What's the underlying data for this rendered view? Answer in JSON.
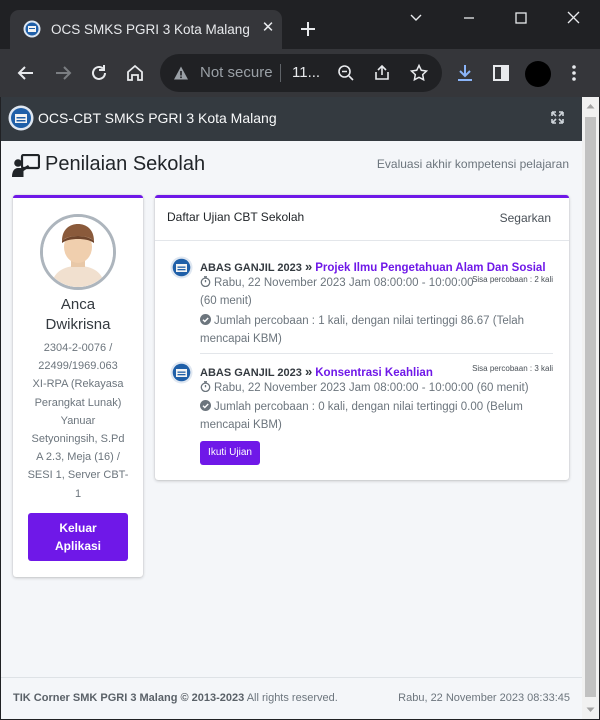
{
  "browser": {
    "tab_title": "OCS SMKS PGRI 3 Kota Malang",
    "security_label": "Not secure",
    "url_text": "11...",
    "colors": {
      "chrome_dark": "#202124",
      "chrome_toolbar": "#35363a"
    }
  },
  "app": {
    "header_title": "OCS-CBT SMKS PGRI 3 Kota Malang",
    "accent_color": "#6f18e8"
  },
  "page": {
    "title": "Penilaian Sekolah",
    "subtitle": "Evaluasi akhir kompetensi pelajaran"
  },
  "student": {
    "first_name": "Anca",
    "last_name": "Dwikrisna",
    "id_line1": "2304-2-0076 /",
    "id_line2": "22499/1969.063",
    "class_line1": "XI-RPA (Rekayasa",
    "class_line2": "Perangkat Lunak)",
    "teacher_line1": "Yanuar",
    "teacher_line2": "Setyoningsih, S.Pd",
    "room_line1": "A 2.3, Meja (16) /",
    "room_line2": "SESI 1, Server CBT-",
    "room_line3": "1",
    "logout_line1": "Keluar",
    "logout_line2": "Aplikasi"
  },
  "exam_list": {
    "title": "Daftar Ujian CBT Sekolah",
    "refresh_label": "Segarkan",
    "items": [
      {
        "session": "ABAS GANJIL 2023",
        "arrows": "»",
        "subject": "Projek Ilmu Pengetahuan Alam Dan Sosial",
        "attempts_left": "Sisa percobaan : 2 kali",
        "schedule_line1": "Rabu, 22 November 2023 Jam 08:00:00 - 10:00:00",
        "schedule_line2": "(60 menit)",
        "result_line1": "Jumlah percobaan : 1 kali, dengan nilai tertinggi 86.67 (Telah",
        "result_line2": "mencapai KBM)"
      },
      {
        "session": "ABAS GANJIL 2023",
        "arrows": "»",
        "subject": "Konsentrasi Keahlian",
        "attempts_left": "Sisa percobaan : 3 kali",
        "schedule_line1": "Rabu, 22 November 2023 Jam 08:00:00 - 10:00:00 (60 menit)",
        "result_line1": "Jumlah percobaan : 0 kali, dengan nilai tertinggi 0.00 (Belum",
        "result_line2": "mencapai KBM)",
        "button_label": "Ikuti Ujian"
      }
    ]
  },
  "footer": {
    "credit": "TIK Corner SMK PGRI 3 Malang © 2013-2023",
    "rights": "All rights reserved.",
    "datetime": "Rabu, 22 November 2023 08:33:45"
  }
}
